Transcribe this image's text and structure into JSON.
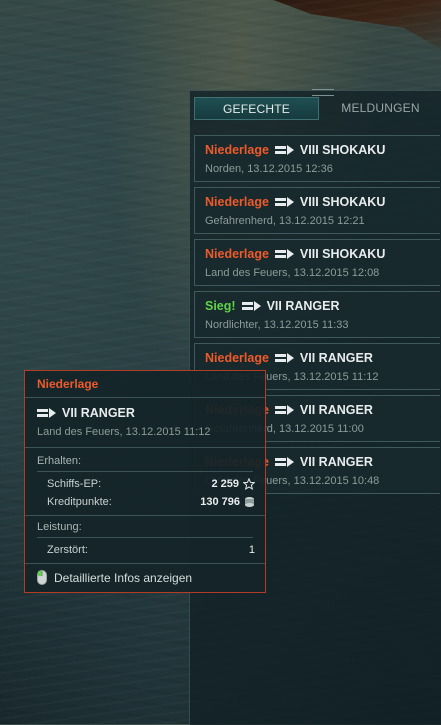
{
  "panel": {
    "tabs": [
      {
        "label": "GEFECHTE",
        "active": true
      },
      {
        "label": "MELDUNGEN",
        "active": false
      }
    ],
    "items": [
      {
        "result": "Niederlage",
        "outcome": "loss",
        "ship": "VIII SHOKAKU",
        "details": "Norden, 13.12.2015 12:36"
      },
      {
        "result": "Niederlage",
        "outcome": "loss",
        "ship": "VIII SHOKAKU",
        "details": "Gefahrenherd, 13.12.2015 12:21"
      },
      {
        "result": "Niederlage",
        "outcome": "loss",
        "ship": "VIII SHOKAKU",
        "details": "Land des Feuers, 13.12.2015 12:08"
      },
      {
        "result": "Sieg!",
        "outcome": "win",
        "ship": "VII RANGER",
        "details": "Nordlichter, 13.12.2015 11:33"
      },
      {
        "result": "Niederlage",
        "outcome": "loss",
        "ship": "VII RANGER",
        "details": "Land des Feuers, 13.12.2015 11:12"
      },
      {
        "result": "Niederlage",
        "outcome": "loss",
        "ship": "VII RANGER",
        "details": "Gefahrenherd, 13.12.2015 11:00"
      },
      {
        "result": "Niederlage",
        "outcome": "loss",
        "ship": "VII RANGER",
        "details": "Land des Feuers, 13.12.2015 10:48"
      }
    ]
  },
  "tooltip": {
    "result": "Niederlage",
    "ship": "VII RANGER",
    "details": "Land des Feuers, 13.12.2015 11:12",
    "received_label": "Erhalten:",
    "xp_label": "Schiffs-EP:",
    "xp_value": "2 259",
    "xp_icon": "star-icon",
    "credits_label": "Kreditpunkte:",
    "credits_value": "130 796",
    "credits_icon": "coins-icon",
    "performance_label": "Leistung:",
    "destroyed_label": "Zerstört:",
    "destroyed_value": "1",
    "more_label": "Detaillierte Infos anzeigen",
    "more_icon": "mouse-icon"
  },
  "colors": {
    "loss": "#ee5a2a",
    "win": "#5fd24a",
    "accent": "#1f4f52"
  }
}
